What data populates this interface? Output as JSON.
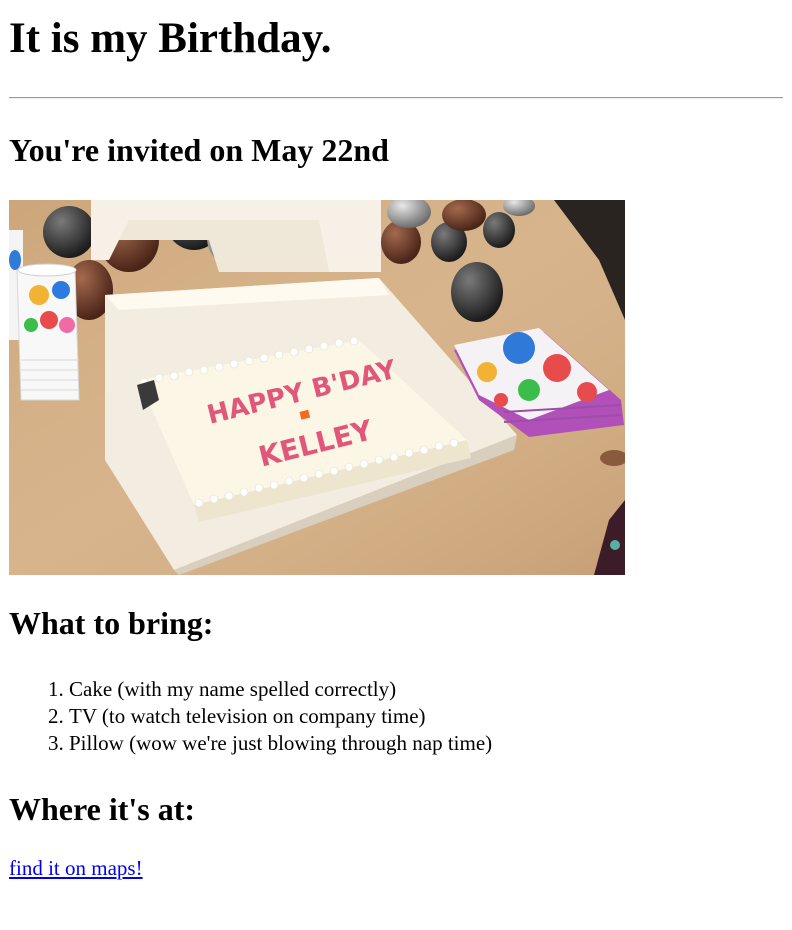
{
  "page": {
    "title": "It is my Birthday.",
    "invite_heading": "You're invited on May 22nd",
    "photo": {
      "cake_text_line1": "HAPPY B'DAY",
      "cake_text_line2": "KELLEY"
    },
    "bring_heading": "What to bring:",
    "bring_items": [
      "Cake (with my name spelled correctly)",
      "TV (to watch television on company time)",
      "Pillow (wow we're just blowing through nap time)"
    ],
    "where_heading": "Where it's at:",
    "map_link_label": "find it on maps!"
  },
  "colors": {
    "link": "#0000ee",
    "table": "#d6b48a",
    "frosting": "#fbf6e6",
    "icing_text": "#e0577a"
  }
}
